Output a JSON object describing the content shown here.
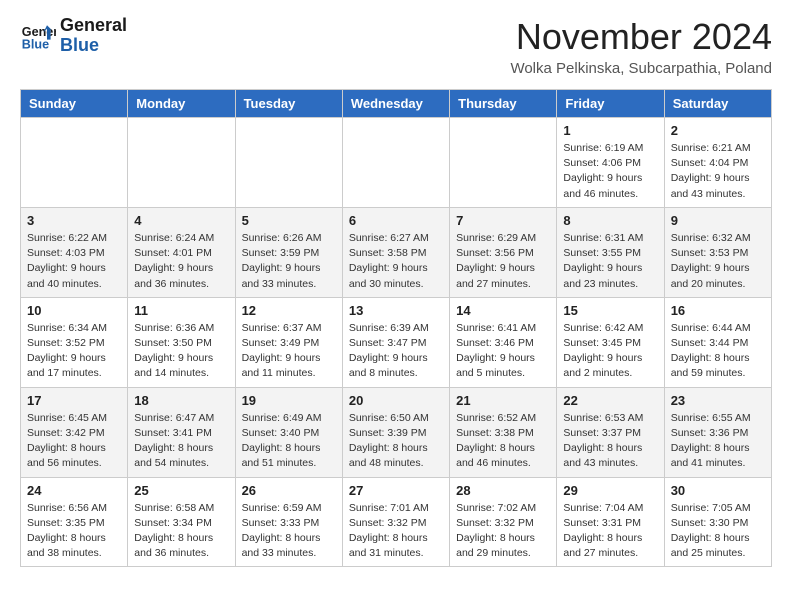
{
  "logo": {
    "line1": "General",
    "line2": "Blue"
  },
  "title": "November 2024",
  "location": "Wolka Pelkinska, Subcarpathia, Poland",
  "days_of_week": [
    "Sunday",
    "Monday",
    "Tuesday",
    "Wednesday",
    "Thursday",
    "Friday",
    "Saturday"
  ],
  "weeks": [
    [
      {
        "day": "",
        "info": ""
      },
      {
        "day": "",
        "info": ""
      },
      {
        "day": "",
        "info": ""
      },
      {
        "day": "",
        "info": ""
      },
      {
        "day": "",
        "info": ""
      },
      {
        "day": "1",
        "info": "Sunrise: 6:19 AM\nSunset: 4:06 PM\nDaylight: 9 hours and 46 minutes."
      },
      {
        "day": "2",
        "info": "Sunrise: 6:21 AM\nSunset: 4:04 PM\nDaylight: 9 hours and 43 minutes."
      }
    ],
    [
      {
        "day": "3",
        "info": "Sunrise: 6:22 AM\nSunset: 4:03 PM\nDaylight: 9 hours and 40 minutes."
      },
      {
        "day": "4",
        "info": "Sunrise: 6:24 AM\nSunset: 4:01 PM\nDaylight: 9 hours and 36 minutes."
      },
      {
        "day": "5",
        "info": "Sunrise: 6:26 AM\nSunset: 3:59 PM\nDaylight: 9 hours and 33 minutes."
      },
      {
        "day": "6",
        "info": "Sunrise: 6:27 AM\nSunset: 3:58 PM\nDaylight: 9 hours and 30 minutes."
      },
      {
        "day": "7",
        "info": "Sunrise: 6:29 AM\nSunset: 3:56 PM\nDaylight: 9 hours and 27 minutes."
      },
      {
        "day": "8",
        "info": "Sunrise: 6:31 AM\nSunset: 3:55 PM\nDaylight: 9 hours and 23 minutes."
      },
      {
        "day": "9",
        "info": "Sunrise: 6:32 AM\nSunset: 3:53 PM\nDaylight: 9 hours and 20 minutes."
      }
    ],
    [
      {
        "day": "10",
        "info": "Sunrise: 6:34 AM\nSunset: 3:52 PM\nDaylight: 9 hours and 17 minutes."
      },
      {
        "day": "11",
        "info": "Sunrise: 6:36 AM\nSunset: 3:50 PM\nDaylight: 9 hours and 14 minutes."
      },
      {
        "day": "12",
        "info": "Sunrise: 6:37 AM\nSunset: 3:49 PM\nDaylight: 9 hours and 11 minutes."
      },
      {
        "day": "13",
        "info": "Sunrise: 6:39 AM\nSunset: 3:47 PM\nDaylight: 9 hours and 8 minutes."
      },
      {
        "day": "14",
        "info": "Sunrise: 6:41 AM\nSunset: 3:46 PM\nDaylight: 9 hours and 5 minutes."
      },
      {
        "day": "15",
        "info": "Sunrise: 6:42 AM\nSunset: 3:45 PM\nDaylight: 9 hours and 2 minutes."
      },
      {
        "day": "16",
        "info": "Sunrise: 6:44 AM\nSunset: 3:44 PM\nDaylight: 8 hours and 59 minutes."
      }
    ],
    [
      {
        "day": "17",
        "info": "Sunrise: 6:45 AM\nSunset: 3:42 PM\nDaylight: 8 hours and 56 minutes."
      },
      {
        "day": "18",
        "info": "Sunrise: 6:47 AM\nSunset: 3:41 PM\nDaylight: 8 hours and 54 minutes."
      },
      {
        "day": "19",
        "info": "Sunrise: 6:49 AM\nSunset: 3:40 PM\nDaylight: 8 hours and 51 minutes."
      },
      {
        "day": "20",
        "info": "Sunrise: 6:50 AM\nSunset: 3:39 PM\nDaylight: 8 hours and 48 minutes."
      },
      {
        "day": "21",
        "info": "Sunrise: 6:52 AM\nSunset: 3:38 PM\nDaylight: 8 hours and 46 minutes."
      },
      {
        "day": "22",
        "info": "Sunrise: 6:53 AM\nSunset: 3:37 PM\nDaylight: 8 hours and 43 minutes."
      },
      {
        "day": "23",
        "info": "Sunrise: 6:55 AM\nSunset: 3:36 PM\nDaylight: 8 hours and 41 minutes."
      }
    ],
    [
      {
        "day": "24",
        "info": "Sunrise: 6:56 AM\nSunset: 3:35 PM\nDaylight: 8 hours and 38 minutes."
      },
      {
        "day": "25",
        "info": "Sunrise: 6:58 AM\nSunset: 3:34 PM\nDaylight: 8 hours and 36 minutes."
      },
      {
        "day": "26",
        "info": "Sunrise: 6:59 AM\nSunset: 3:33 PM\nDaylight: 8 hours and 33 minutes."
      },
      {
        "day": "27",
        "info": "Sunrise: 7:01 AM\nSunset: 3:32 PM\nDaylight: 8 hours and 31 minutes."
      },
      {
        "day": "28",
        "info": "Sunrise: 7:02 AM\nSunset: 3:32 PM\nDaylight: 8 hours and 29 minutes."
      },
      {
        "day": "29",
        "info": "Sunrise: 7:04 AM\nSunset: 3:31 PM\nDaylight: 8 hours and 27 minutes."
      },
      {
        "day": "30",
        "info": "Sunrise: 7:05 AM\nSunset: 3:30 PM\nDaylight: 8 hours and 25 minutes."
      }
    ]
  ]
}
